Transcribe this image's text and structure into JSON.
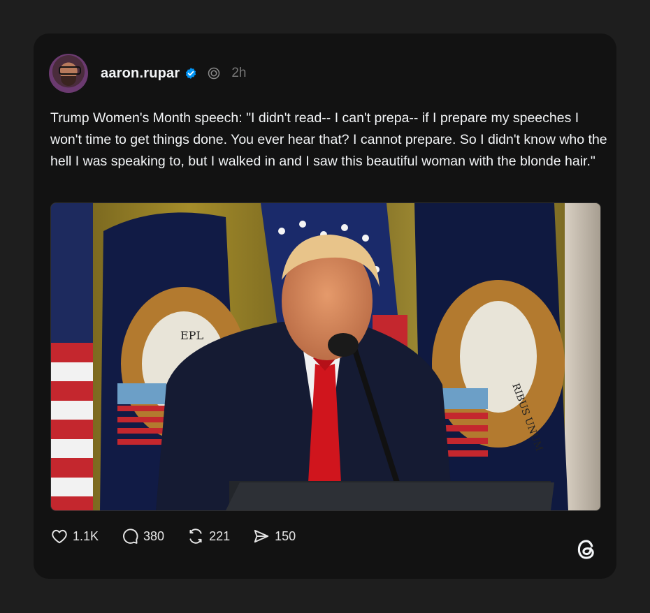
{
  "post": {
    "username": "aaron.rupar",
    "time": "2h",
    "text": "Trump Women's Month speech: \"I didn't read-- I can't prepa-- if I prepare my speeches I won't time to get things done. You ever hear that? I cannot prepare. So I didn't know who the hell I was speaking to, but I walked in and I saw this beautiful woman with the blonde hair.\"",
    "media_seal_text": "EPL",
    "media_seal_text_right": "RIBUS UNUM"
  },
  "actions": {
    "likes": "1.1K",
    "replies": "380",
    "reposts": "221",
    "shares": "150"
  },
  "icons": {
    "verified": "verified-badge-icon",
    "repost_indicator": "reposted-by-icon",
    "like": "heart-icon",
    "reply": "speech-bubble-icon",
    "repost": "repost-arrows-icon",
    "share": "send-icon",
    "brand": "threads-logo-icon"
  },
  "colors": {
    "background": "#1e1e1e",
    "card": "#121212",
    "verified_blue": "#0095f6",
    "text": "#f3f5f7",
    "muted": "#777777"
  }
}
